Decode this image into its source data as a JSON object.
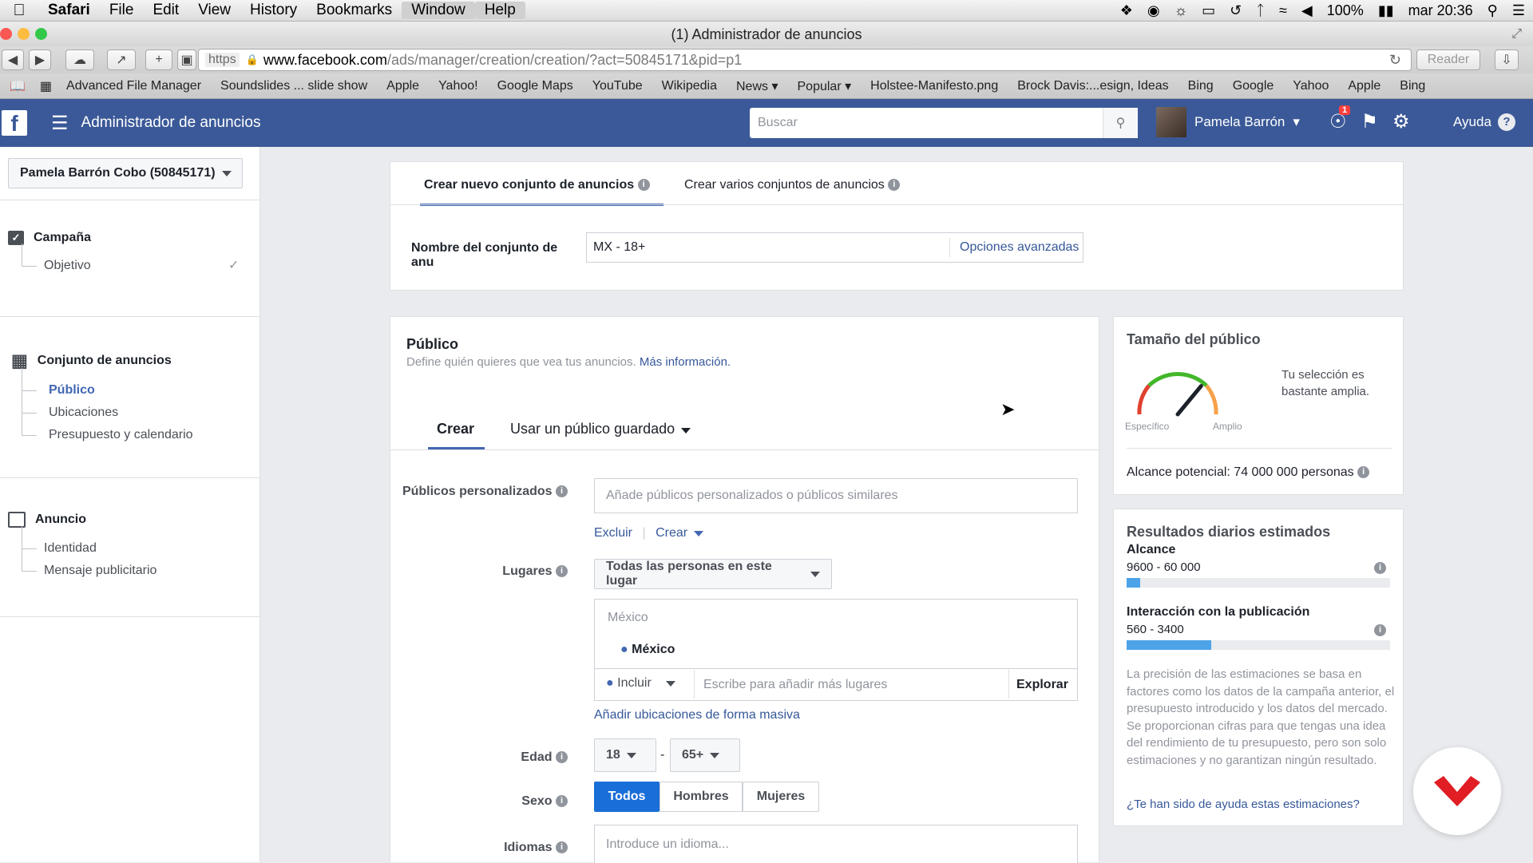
{
  "menubar": {
    "app": "Safari",
    "items": [
      "File",
      "Edit",
      "View",
      "History",
      "Bookmarks",
      "Window",
      "Help"
    ],
    "battery": "100%",
    "clock": "mar 20:36"
  },
  "window": {
    "title": "(1) Administrador de anuncios"
  },
  "toolbar": {
    "url_scheme": "https",
    "url_domain": "www.facebook.com",
    "url_path": "/ads/manager/creation/creation/?act=50845171&pid=p1",
    "reader": "Reader"
  },
  "bookmarks": [
    "Advanced File Manager",
    "Soundslides ... slide show",
    "Apple",
    "Yahoo!",
    "Google Maps",
    "YouTube",
    "Wikipedia",
    "News",
    "Popular",
    "Holstee-Manifesto.png",
    "Brock Davis:...esign, Ideas",
    "Bing",
    "Google",
    "Yahoo",
    "Apple",
    "Bing"
  ],
  "fbheader": {
    "title": "Administrador de anuncios",
    "search_placeholder": "Buscar",
    "user_name": "Pamela Barrón",
    "notif_count": "1",
    "help": "Ayuda"
  },
  "sidebar": {
    "account": "Pamela Barrón Cobo (50845171)",
    "campaign": {
      "title": "Campaña",
      "items": [
        "Objetivo"
      ]
    },
    "adset": {
      "title": "Conjunto de anuncios",
      "items": [
        "Público",
        "Ubicaciones",
        "Presupuesto y calendario"
      ]
    },
    "ad": {
      "title": "Anuncio",
      "items": [
        "Identidad",
        "Mensaje publicitario"
      ]
    }
  },
  "top_panel": {
    "tab_new": "Crear nuevo conjunto de anuncios",
    "tab_multi": "Crear varios conjuntos de anuncios",
    "name_label": "Nombre del conjunto de anu",
    "name_value": "MX - 18+",
    "advanced": "Opciones avanzadas"
  },
  "audience": {
    "title": "Público",
    "desc": "Define quién quieres que vea tus anuncios.",
    "more": "Más información.",
    "tab_create": "Crear",
    "tab_saved": "Usar un público guardado",
    "custom_label": "Públicos personalizados",
    "custom_placeholder": "Añade públicos personalizados o públicos similares",
    "exclude": "Excluir",
    "create": "Crear",
    "places_label": "Lugares",
    "places_select": "Todas las personas en este lugar",
    "location_country": "México",
    "location_selected": "México",
    "include": "Incluir",
    "places_placeholder": "Escribe para añadir más lugares",
    "explore": "Explorar",
    "bulk": "Añadir ubicaciones de forma masiva",
    "age_label": "Edad",
    "age_min": "18",
    "age_sep": "-",
    "age_max": "65+",
    "sex_label": "Sexo",
    "sex_options": [
      "Todos",
      "Hombres",
      "Mujeres"
    ],
    "lang_label": "Idiomas",
    "lang_placeholder": "Introduce un idioma..."
  },
  "size_panel": {
    "title": "Tamaño del público",
    "verdict": "Tu selección es bastante amplia.",
    "specific": "Específico",
    "broad": "Amplio",
    "reach": "Alcance potencial: 74 000 000 personas",
    "gauge_level": 0.72
  },
  "daily_panel": {
    "title": "Resultados diarios estimados",
    "reach_label": "Alcance",
    "reach_value": "9600 - 60 000",
    "reach_fill": 0.05,
    "engage_label": "Interacción con la publicación",
    "engage_value": "560 - 3400",
    "engage_fill": 0.32,
    "note": "La precisión de las estimaciones se basa en factores como los datos de la campaña anterior, el presupuesto introducido y los datos del mercado. Se proporcionan cifras para que tengas una idea del rendimiento de tu presupuesto, pero son solo estimaciones y no garantizan ningún resultado.",
    "feedback": "¿Te han sido de ayuda estas estimaciones?"
  },
  "colors": {
    "fb_blue": "#3b5998",
    "link": "#365899",
    "bar": "#4da3e8",
    "active_btn": "#1877f2"
  }
}
